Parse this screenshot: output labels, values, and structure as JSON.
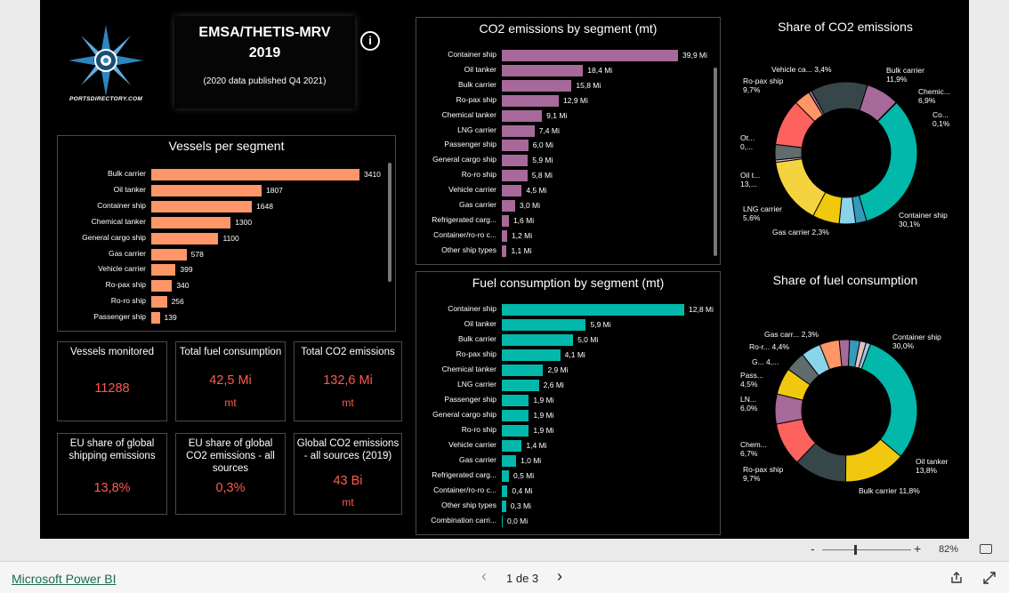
{
  "header": {
    "title_line1": "EMSA/THETIS-MRV",
    "title_line2": "2019",
    "subtitle": "(2020 data published Q4 2021)",
    "logo_text": "PORTSDIRECTORY.COM"
  },
  "vessels": {
    "title": "Vessels per segment",
    "rows": [
      {
        "label": "Bulk carrier",
        "value": 3410,
        "text": "3410"
      },
      {
        "label": "Oil tanker",
        "value": 1807,
        "text": "1807"
      },
      {
        "label": "Container ship",
        "value": 1648,
        "text": "1648"
      },
      {
        "label": "Chemical tanker",
        "value": 1300,
        "text": "1300"
      },
      {
        "label": "General cargo ship",
        "value": 1100,
        "text": "1100"
      },
      {
        "label": "Gas carrier",
        "value": 578,
        "text": "578"
      },
      {
        "label": "Vehicle carrier",
        "value": 399,
        "text": "399"
      },
      {
        "label": "Ro-pax ship",
        "value": 340,
        "text": "340"
      },
      {
        "label": "Ro-ro ship",
        "value": 256,
        "text": "256"
      },
      {
        "label": "Passenger ship",
        "value": 139,
        "text": "139"
      }
    ]
  },
  "co2": {
    "title": "CO2 emissions by segment (mt)",
    "rows": [
      {
        "label": "Container ship",
        "value": 39.9,
        "text": "39,9 Mi"
      },
      {
        "label": "Oil tanker",
        "value": 18.4,
        "text": "18,4 Mi"
      },
      {
        "label": "Bulk carrier",
        "value": 15.8,
        "text": "15,8 Mi"
      },
      {
        "label": "Ro-pax ship",
        "value": 12.9,
        "text": "12,9 Mi"
      },
      {
        "label": "Chemical tanker",
        "value": 9.1,
        "text": "9,1 Mi"
      },
      {
        "label": "LNG carrier",
        "value": 7.4,
        "text": "7,4 Mi"
      },
      {
        "label": "Passenger ship",
        "value": 6.0,
        "text": "6,0 Mi"
      },
      {
        "label": "General cargo ship",
        "value": 5.9,
        "text": "5,9 Mi"
      },
      {
        "label": "Ro-ro ship",
        "value": 5.8,
        "text": "5,8 Mi"
      },
      {
        "label": "Vehicle carrier",
        "value": 4.5,
        "text": "4,5 Mi"
      },
      {
        "label": "Gas carrier",
        "value": 3.0,
        "text": "3,0 Mi"
      },
      {
        "label": "Refrigerated carg...",
        "value": 1.6,
        "text": "1,6 Mi"
      },
      {
        "label": "Container/ro-ro c...",
        "value": 1.2,
        "text": "1,2 Mi"
      },
      {
        "label": "Other ship types",
        "value": 1.1,
        "text": "1,1 Mi"
      }
    ]
  },
  "fuel": {
    "title": "Fuel consumption by segment (mt)",
    "rows": [
      {
        "label": "Container ship",
        "value": 12.8,
        "text": "12,8 Mi"
      },
      {
        "label": "Oil tanker",
        "value": 5.9,
        "text": "5,9 Mi"
      },
      {
        "label": "Bulk carrier",
        "value": 5.0,
        "text": "5,0 Mi"
      },
      {
        "label": "Ro-pax ship",
        "value": 4.1,
        "text": "4,1 Mi"
      },
      {
        "label": "Chemical tanker",
        "value": 2.9,
        "text": "2,9 Mi"
      },
      {
        "label": "LNG carrier",
        "value": 2.6,
        "text": "2,6 Mi"
      },
      {
        "label": "Passenger ship",
        "value": 1.9,
        "text": "1,9 Mi"
      },
      {
        "label": "General cargo ship",
        "value": 1.9,
        "text": "1,9 Mi"
      },
      {
        "label": "Ro-ro ship",
        "value": 1.9,
        "text": "1,9 Mi"
      },
      {
        "label": "Vehicle carrier",
        "value": 1.4,
        "text": "1,4 Mi"
      },
      {
        "label": "Gas carrier",
        "value": 1.0,
        "text": "1,0 Mi"
      },
      {
        "label": "Refrigerated carg...",
        "value": 0.5,
        "text": "0,5 Mi"
      },
      {
        "label": "Container/ro-ro c...",
        "value": 0.4,
        "text": "0,4 Mi"
      },
      {
        "label": "Other ship types",
        "value": 0.3,
        "text": "0,3 Mi"
      },
      {
        "label": "Combination carri...",
        "value": 0.0,
        "text": "0,0 Mi"
      }
    ]
  },
  "kpis": [
    {
      "title": "Vessels monitored",
      "value": "11288",
      "unit": ""
    },
    {
      "title": "Total fuel consumption",
      "value": "42,5 Mi",
      "unit": "mt"
    },
    {
      "title": "Total CO2 emissions",
      "value": "132,6 Mi",
      "unit": "mt"
    },
    {
      "title": "EU share of global shipping emissions",
      "value": "13,8%",
      "unit": ""
    },
    {
      "title": "EU share of global CO2 emissions - all sources",
      "value": "0,3%",
      "unit": ""
    },
    {
      "title": "Global CO2 emissions - all sources (2019)",
      "value": "43 Bi",
      "unit": "mt"
    }
  ],
  "share_co2": {
    "title": "Share of CO2 emissions",
    "labels": [
      {
        "line1": "Bulk carrier",
        "line2": "11,9%"
      },
      {
        "line1": "Chemic...",
        "line2": "6,9%"
      },
      {
        "line1": "Co...",
        "line2": "0,1%"
      },
      {
        "line1": "Container ship",
        "line2": "30,1%"
      },
      {
        "line1": "Gas carrier 2,3%",
        "line2": ""
      },
      {
        "line1": "LNG carrier",
        "line2": "5,6%"
      },
      {
        "line1": "Oil t...",
        "line2": "13,..."
      },
      {
        "line1": "Ot...",
        "line2": "0,..."
      },
      {
        "line1": "Ro-pax ship",
        "line2": "9,7%"
      },
      {
        "line1": "Vehicle ca... 3,4%",
        "line2": ""
      }
    ]
  },
  "share_fuel": {
    "title": "Share of fuel consumption",
    "labels": [
      {
        "line1": "Container ship",
        "line2": "30,0%"
      },
      {
        "line1": "Oil tanker",
        "line2": "13,8%"
      },
      {
        "line1": "Bulk carrier 11,8%",
        "line2": ""
      },
      {
        "line1": "Ro-pax ship",
        "line2": "9,7%"
      },
      {
        "line1": "Chem...",
        "line2": "6,7%"
      },
      {
        "line1": "LN...",
        "line2": "6,0%"
      },
      {
        "line1": "Pass...",
        "line2": "4,5%"
      },
      {
        "line1": "G... 4,...",
        "line2": ""
      },
      {
        "line1": "Ro-r... 4,4%",
        "line2": ""
      },
      {
        "line1": "Gas carr... 2,3%",
        "line2": ""
      }
    ]
  },
  "colors": {
    "vessels_bar": "#fe9668",
    "co2_bar": "#a66999",
    "fuel_bar": "#01b8aa",
    "kpi_value": "#ff5a4e"
  },
  "donut_co2": [
    {
      "value": 30.1,
      "color": "#01b8aa"
    },
    {
      "value": 2.3,
      "color": "#3599b8"
    },
    {
      "value": 3.4,
      "color": "#8ad4eb"
    },
    {
      "value": 5.6,
      "color": "#f2c80f"
    },
    {
      "value": 13.9,
      "color": "#f5d33f"
    },
    {
      "value": 0.5,
      "color": "#dfbfbf"
    },
    {
      "value": 3.2,
      "color": "#5f6b6d"
    },
    {
      "value": 9.7,
      "color": "#fd625e"
    },
    {
      "value": 3.4,
      "color": "#fe9666"
    },
    {
      "value": 0.6,
      "color": "#a66999"
    },
    {
      "value": 11.9,
      "color": "#374649"
    },
    {
      "value": 6.9,
      "color": "#a66999"
    },
    {
      "value": 0.1,
      "color": "#ffffff"
    }
  ],
  "donut_fuel": [
    {
      "value": 30.0,
      "color": "#01b8aa"
    },
    {
      "value": 13.8,
      "color": "#f2c80f"
    },
    {
      "value": 11.8,
      "color": "#374649"
    },
    {
      "value": 9.7,
      "color": "#fd625e"
    },
    {
      "value": 6.7,
      "color": "#a66999"
    },
    {
      "value": 6.0,
      "color": "#f2c80f"
    },
    {
      "value": 4.5,
      "color": "#5f6b6d"
    },
    {
      "value": 4.4,
      "color": "#8ad4eb"
    },
    {
      "value": 4.4,
      "color": "#fe9666"
    },
    {
      "value": 2.3,
      "color": "#a66999"
    },
    {
      "value": 2.3,
      "color": "#3599b8"
    },
    {
      "value": 1.4,
      "color": "#dfbfbf"
    },
    {
      "value": 1.0,
      "color": "#9ec6e8"
    }
  ],
  "zoom": {
    "minus": "-",
    "plus": "+",
    "level": "82%"
  },
  "footer": {
    "brand": "Microsoft Power BI",
    "page": "1 de 3",
    "prev": "‹",
    "next": "›"
  }
}
